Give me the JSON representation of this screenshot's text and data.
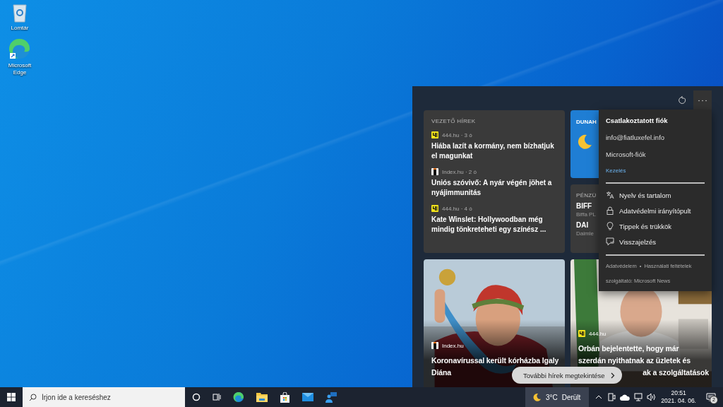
{
  "desktop_icons": [
    {
      "label": "Lomtár",
      "kind": "recycle-bin"
    },
    {
      "label": "Microsoft Edge",
      "kind": "edge"
    }
  ],
  "news_panel": {
    "top_stories": {
      "heading": "VEZETŐ HÍREK",
      "items": [
        {
          "kind": "yellow-logo",
          "source": "444.hu · 3 ó",
          "title": "Hiába lazít a kormány, nem bízhatjuk el magunkat"
        },
        {
          "kind": "white-logo",
          "source": "Index.hu · 2 ó",
          "title": "Uniós szóvivő: A nyár végén jöhet a nyájimmunitás"
        },
        {
          "kind": "yellow-logo",
          "source": "444.hu · 4 ó",
          "title": "Kate Winslet: Hollywoodban még mindig tönkreteheti egy színész ..."
        }
      ]
    },
    "weather_card": {
      "heading": "DUNAH"
    },
    "finance_card": {
      "heading": "PÉNZÜ",
      "stocks": [
        {
          "symbol": "BIFF",
          "name": "Biffa PL"
        },
        {
          "symbol": "DAI",
          "name": "Daimle"
        }
      ]
    },
    "image_cards": [
      {
        "kind": "white-logo",
        "source": "Index.hu",
        "title_lines": [
          "Koronavírussal került kórházba Igaly",
          "Diána"
        ]
      },
      {
        "kind": "yellow-logo",
        "source": "444.hu",
        "title_lines": [
          "Orbán bejelentette, hogy már",
          "szerdán nyithatnak az üzletek és",
          "ak a szolgáltatások"
        ]
      }
    ],
    "more_button": "További hírek megtekintése",
    "menu": {
      "heading": "Csatlakoztatott fiók",
      "email": "info@fiatluxefel.info",
      "account": "Microsoft-fiók",
      "manage": "Kezelés",
      "items": [
        {
          "label": "Nyelv és tartalom",
          "kind": "language"
        },
        {
          "label": "Adatvédelmi irányítópult",
          "kind": "lock"
        },
        {
          "label": "Tippek és trükkök",
          "kind": "bulb"
        },
        {
          "label": "Visszajelzés",
          "kind": "feedback"
        }
      ],
      "footer_links": [
        "Adatvédelem",
        "Használati feltételek"
      ],
      "footer_separator": "•",
      "provider": "szolgáltató: Microsoft News"
    }
  },
  "taskbar": {
    "search_placeholder": "Írjon ide a kereséshez",
    "pinned": [
      {
        "kind": "cortana"
      },
      {
        "kind": "task-view"
      },
      {
        "kind": "edge"
      },
      {
        "kind": "folder"
      },
      {
        "kind": "store"
      },
      {
        "kind": "mail"
      },
      {
        "kind": "people"
      }
    ],
    "weather": {
      "temperature": "3°C",
      "condition": "Derült"
    },
    "tray": [
      {
        "kind": "chevron"
      },
      {
        "kind": "meet"
      },
      {
        "kind": "cloud"
      },
      {
        "kind": "network"
      },
      {
        "kind": "volume"
      }
    ],
    "time": "20:51",
    "date": "2021. 04. 06.",
    "notification_count": "2"
  }
}
